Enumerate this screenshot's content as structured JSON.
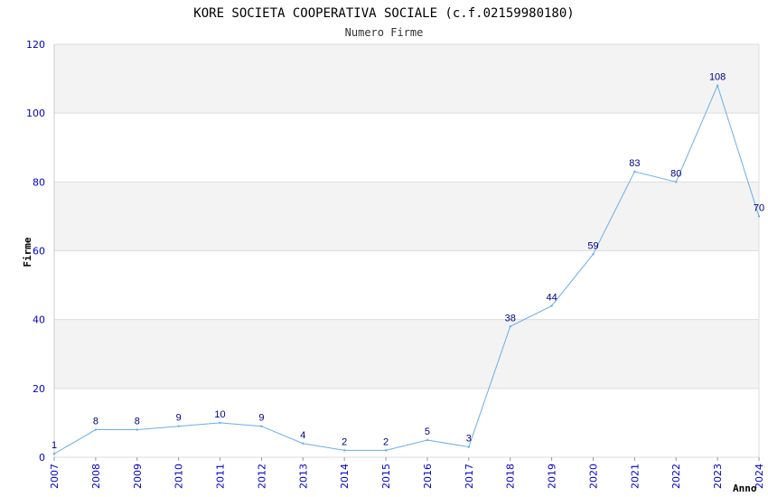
{
  "chart_data": {
    "type": "line",
    "title": "KORE SOCIETA COOPERATIVA SOCIALE (c.f.02159980180)",
    "subtitle": "Numero Firme",
    "xlabel": "Anno",
    "ylabel": "Firme",
    "ylim": [
      0,
      120
    ],
    "yticks": [
      "0",
      "20",
      "40",
      "60",
      "80",
      "100",
      "120"
    ],
    "categories": [
      "2007",
      "2008",
      "2009",
      "2010",
      "2011",
      "2012",
      "2013",
      "2014",
      "2015",
      "2016",
      "2017",
      "2018",
      "2019",
      "2020",
      "2021",
      "2022",
      "2023",
      "2024"
    ],
    "values": [
      1,
      8,
      8,
      9,
      10,
      9,
      4,
      2,
      2,
      5,
      3,
      38,
      44,
      59,
      83,
      80,
      108,
      70
    ],
    "grid": true,
    "band_colors": [
      "#f3f3f3",
      "#ffffff"
    ],
    "line_color": "#6aaee8"
  }
}
